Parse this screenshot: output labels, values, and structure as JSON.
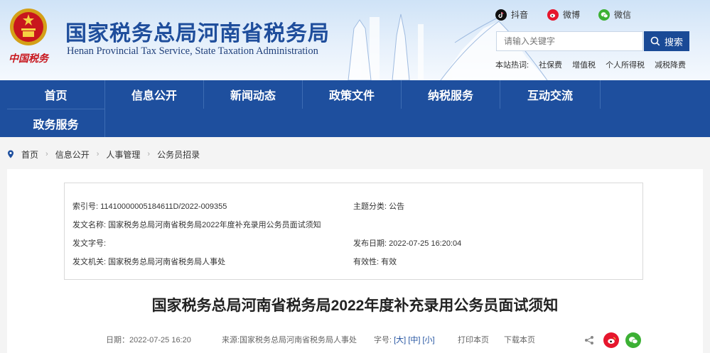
{
  "header": {
    "title": "国家税务总局河南省税务局",
    "subtitle": "Henan Provincial Tax Service, State Taxation Administration",
    "logo_text": "中国税务",
    "social": [
      {
        "label": "抖音",
        "icon": "douyin-icon"
      },
      {
        "label": "微博",
        "icon": "weibo-icon"
      },
      {
        "label": "微信",
        "icon": "wechat-icon"
      }
    ],
    "search": {
      "placeholder": "请输入关键字",
      "button_label": "搜索"
    },
    "hot": {
      "label": "本站热词:",
      "words": [
        "社保费",
        "增值税",
        "个人所得税",
        "减税降费"
      ]
    }
  },
  "nav": {
    "items": [
      "首页",
      "信息公开",
      "新闻动态",
      "政策文件",
      "纳税服务",
      "互动交流",
      "政务服务"
    ]
  },
  "breadcrumb": [
    "首页",
    "信息公开",
    "人事管理",
    "公务员招录"
  ],
  "meta": {
    "index_label": "索引号:",
    "index_value": "11410000005184611D/2022-009355",
    "topic_label": "主题分类:",
    "topic_value": "公告",
    "name_label": "发文名称:",
    "name_value": "国家税务总局河南省税务局2022年度补充录用公务员面试须知",
    "docno_label": "发文字号:",
    "docno_value": "",
    "date_label": "发布日期:",
    "date_value": "2022-07-25 16:20:04",
    "org_label": "发文机关:",
    "org_value": "国家税务总局河南省税务局人事处",
    "valid_label": "有效性:",
    "valid_value": "有效"
  },
  "article": {
    "title": "国家税务总局河南省税务局2022年度补充录用公务员面试须知",
    "date": "日期：2022-07-25 16:20",
    "source": "来源:国家税务总局河南省税务局人事处",
    "font_label": "字号:",
    "font_sizes": [
      "[大]",
      "[中]",
      "[小]"
    ],
    "print": "打印本页",
    "download": "下载本页"
  },
  "colors": {
    "brand_blue": "#1e4f9e",
    "weibo_red": "#e6162d",
    "wechat_green": "#3cb034"
  }
}
